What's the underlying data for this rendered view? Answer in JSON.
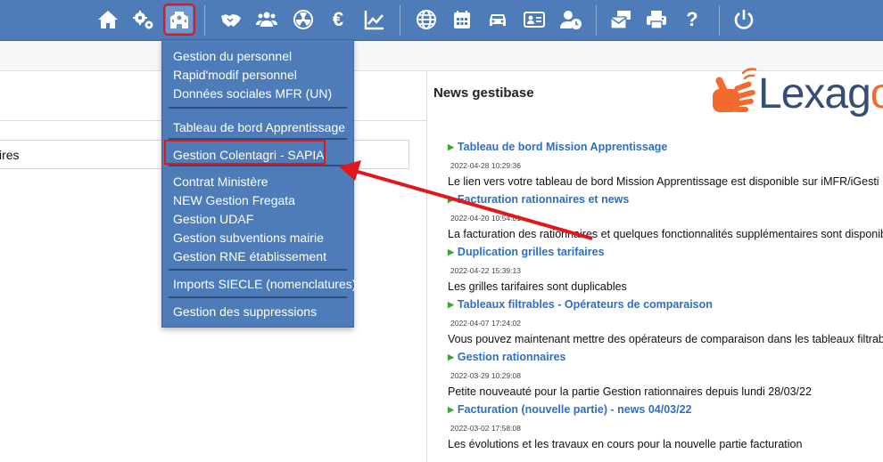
{
  "toolbar": {
    "icons": [
      "home-icon",
      "gears-icon",
      "school-icon",
      "handshake-icon",
      "users-icon",
      "radiation-icon",
      "euro-icon",
      "chart-line-icon",
      "globe-icon",
      "calendar-icon",
      "car-icon",
      "id-card-icon",
      "user-clock-icon",
      "mail-bulk-icon",
      "printer-icon",
      "help-icon",
      "power-icon"
    ],
    "euro_glyph": "€",
    "help_glyph": "?"
  },
  "left": {
    "field_text": "ires"
  },
  "news": {
    "title": "News gestibase",
    "items": [
      {
        "title": "Tableau de bord Mission Apprentissage",
        "date": "2022-04-28 10:29:36",
        "desc": "Le lien vers votre tableau de bord Mission Apprentissage est disponible sur iMFR/iGesti"
      },
      {
        "title": "Facturation rationnaires et news",
        "date": "2022-04-20 10:54:01",
        "desc": "La facturation des rationnaires et quelques fonctionnalités supplémentaires sont disponibles"
      },
      {
        "title": "Duplication grilles tarifaires",
        "date": "2022-04-22 15:39:13",
        "desc": "Les grilles tarifaires sont duplicables"
      },
      {
        "title": "Tableaux filtrables - Opérateurs de comparaison",
        "date": "2022-04-07 17:24:02",
        "desc": "Vous pouvez maintenant mettre des opérateurs de comparaison dans les tableaux filtrables"
      },
      {
        "title": "Gestion rationnaires",
        "date": "2022-03-29 10:29:08",
        "desc": "Petite nouveauté pour la partie Gestion rationnaires depuis lundi 28/03/22"
      },
      {
        "title": "Facturation (nouvelle partie) - news 04/03/22",
        "date": "2022-03-02 17:58:08",
        "desc": "Les évolutions et les travaux en cours pour la nouvelle partie facturation"
      }
    ]
  },
  "logo": {
    "text_a": "Lexag",
    "text_b": "o"
  },
  "dropdown": {
    "group1": [
      "Gestion du personnel",
      "Rapid'modif personnel",
      "Données sociales MFR (UN)"
    ],
    "group2": [
      "Tableau de bord Apprentissage"
    ],
    "group3": [
      "Gestion Colentagri - SAPIA"
    ],
    "group4": [
      "Contrat Ministère",
      "NEW Gestion Fregata",
      "Gestion UDAF",
      "Gestion subventions mairie",
      "Gestion RNE établissement"
    ],
    "group5": [
      "Imports SIECLE (nomenclatures)"
    ],
    "group6": [
      "Gestion des suppressions"
    ]
  },
  "colors": {
    "toolbar": "#4d7cb8",
    "highlight": "#e3161b",
    "link": "#2f6fc0",
    "logo_dark": "#364e74",
    "logo_orange": "#f26a2e"
  }
}
